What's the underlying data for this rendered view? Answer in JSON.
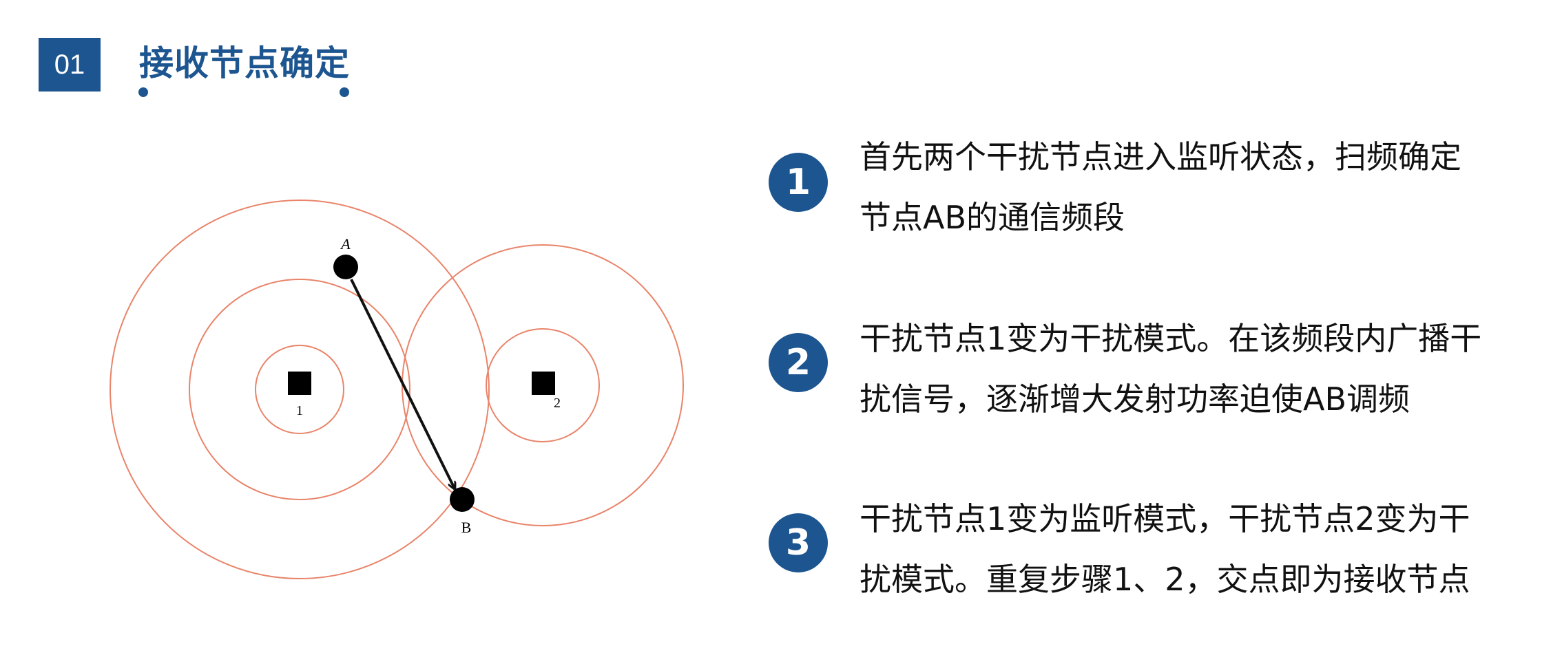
{
  "header": {
    "badge": "01",
    "title": "接收节点确定"
  },
  "colors": {
    "primary": "#1c5590",
    "circle": "#e9846a",
    "text": "#111111"
  },
  "diagram": {
    "node_a_label": "A",
    "node_b_label": "B",
    "jammer_1_label": "1",
    "jammer_2_label": "2"
  },
  "steps": [
    {
      "number": "1",
      "lines": [
        "首先两个干扰节点进入监听状态，扫频确定",
        "节点AB的通信频段"
      ]
    },
    {
      "number": "2",
      "lines": [
        "干扰节点1变为干扰模式。在该频段内广播干",
        "扰信号，逐渐增大发射功率迫使AB调频"
      ]
    },
    {
      "number": "3",
      "lines": [
        "干扰节点1变为监听模式，干扰节点2变为干",
        "扰模式。重复步骤1、2，交点即为接收节点"
      ]
    }
  ]
}
